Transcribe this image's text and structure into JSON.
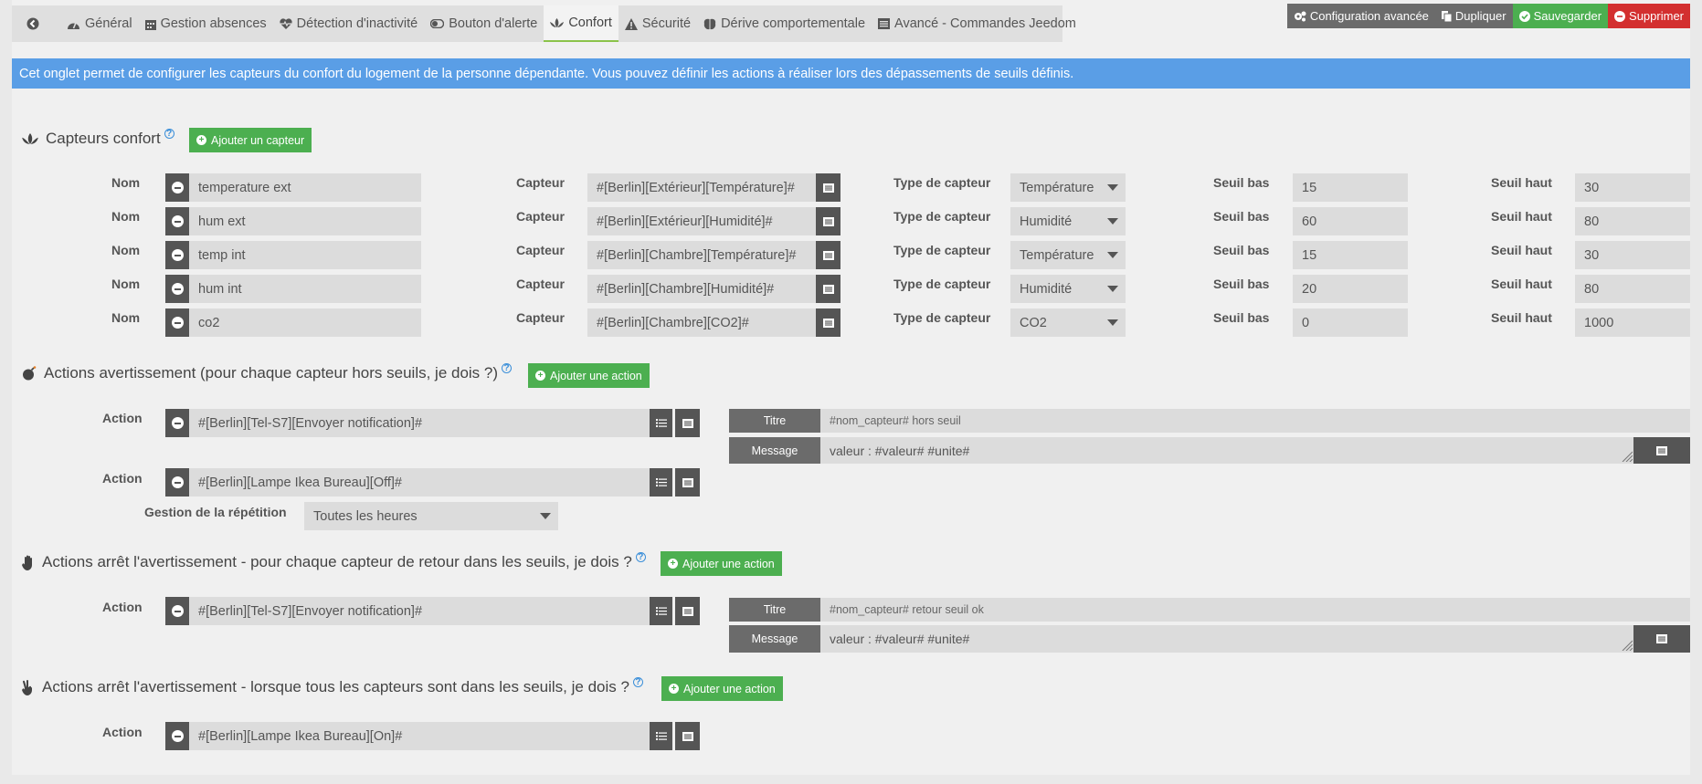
{
  "tabs": [
    {
      "label": "",
      "icon": "back-arrow-icon"
    },
    {
      "label": "Général",
      "icon": "dashboard-icon"
    },
    {
      "label": "Gestion absences",
      "icon": "calendar-icon"
    },
    {
      "label": "Détection d'inactivité",
      "icon": "heartbeat-icon"
    },
    {
      "label": "Bouton d'alerte",
      "icon": "toggle-icon"
    },
    {
      "label": "Confort",
      "icon": "lotus-icon",
      "active": true
    },
    {
      "label": "Sécurité",
      "icon": "warning-icon"
    },
    {
      "label": "Dérive comportementale",
      "icon": "brain-icon"
    },
    {
      "label": "Avancé - Commandes Jeedom",
      "icon": "list-icon"
    }
  ],
  "top_buttons": {
    "config": "Configuration avancée",
    "duplicate": "Dupliquer",
    "save": "Sauvegarder",
    "delete": "Supprimer"
  },
  "colors": {
    "green": "#4caf50",
    "red": "#d32f2f",
    "blue": "#5a9ee6",
    "dark": "#555555"
  },
  "info": "Cet onglet permet de configurer les capteurs du confort du logement de la personne dépendante. Vous pouvez définir les actions à réaliser lors des dépassements de seuils définis.",
  "sensors_section": {
    "title": "Capteurs confort",
    "help": "?",
    "add_label": "Ajouter un capteur",
    "labels": {
      "nom": "Nom",
      "capteur": "Capteur",
      "type": "Type de capteur",
      "seuil_bas": "Seuil bas",
      "seuil_haut": "Seuil haut"
    },
    "rows": [
      {
        "nom": "temperature ext",
        "capteur": "#[Berlin][Extérieur][Température]#",
        "type": "Température",
        "bas": "15",
        "haut": "30"
      },
      {
        "nom": "hum ext",
        "capteur": "#[Berlin][Extérieur][Humidité]#",
        "type": "Humidité",
        "bas": "60",
        "haut": "80"
      },
      {
        "nom": "temp int",
        "capteur": "#[Berlin][Chambre][Température]#",
        "type": "Température",
        "bas": "15",
        "haut": "30"
      },
      {
        "nom": "hum int",
        "capteur": "#[Berlin][Chambre][Humidité]#",
        "type": "Humidité",
        "bas": "20",
        "haut": "80"
      },
      {
        "nom": "co2",
        "capteur": "#[Berlin][Chambre][CO2]#",
        "type": "CO2",
        "bas": "0",
        "haut": "1000"
      }
    ]
  },
  "warning_section": {
    "title": "Actions avertissement (pour chaque capteur hors seuils, je dois ?)",
    "help": "?",
    "add_label": "Ajouter une action",
    "action_label": "Action",
    "actions": [
      "#[Berlin][Tel-S7][Envoyer notification]#",
      "#[Berlin][Lampe Ikea Bureau][Off]#"
    ],
    "titre_label": "Titre",
    "titre_value": "#nom_capteur# hors seuil",
    "message_label": "Message",
    "message_value": "valeur : #valeur# #unite#",
    "repetition_label": "Gestion de la répétition",
    "repetition_value": "Toutes les heures"
  },
  "stop_each_section": {
    "title": "Actions arrêt l'avertissement - pour chaque capteur de retour dans les seuils, je dois ?",
    "help": "?",
    "add_label": "Ajouter une action",
    "action_label": "Action",
    "action": "#[Berlin][Tel-S7][Envoyer notification]#",
    "titre_label": "Titre",
    "titre_value": "#nom_capteur# retour seuil ok",
    "message_label": "Message",
    "message_value": "valeur : #valeur# #unite#"
  },
  "stop_all_section": {
    "title": "Actions arrêt l'avertissement - lorsque tous les capteurs sont dans les seuils, je dois ?",
    "help": "?",
    "add_label": "Ajouter une action",
    "action_label": "Action",
    "action": "#[Berlin][Lampe Ikea Bureau][On]#"
  }
}
